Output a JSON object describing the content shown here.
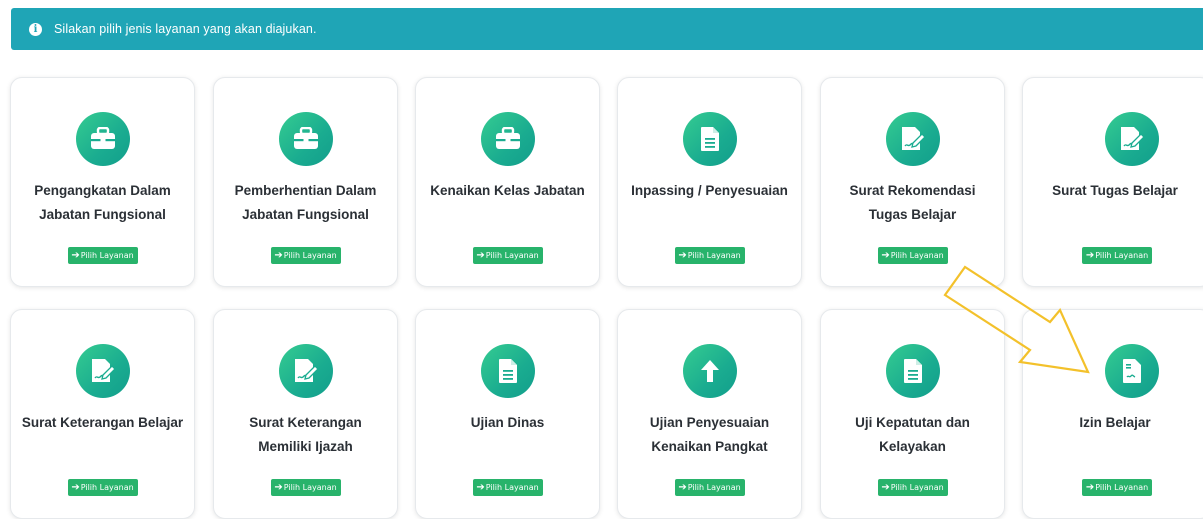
{
  "alert": {
    "icon": "info-icon",
    "text": "Silakan pilih jenis layanan yang akan diajukan."
  },
  "button_label": "Pilih Layanan",
  "services": [
    {
      "title": "Pengangkatan Dalam Jabatan Fungsional",
      "icon": "briefcase-icon"
    },
    {
      "title": "Pemberhentian Dalam Jabatan Fungsional",
      "icon": "briefcase-icon"
    },
    {
      "title": "Kenaikan Kelas Jabatan",
      "icon": "briefcase-icon"
    },
    {
      "title": "Inpassing / Penyesuaian",
      "icon": "document-icon"
    },
    {
      "title": "Surat Rekomendasi Tugas Belajar",
      "icon": "signature-icon"
    },
    {
      "title": "Surat Tugas Belajar",
      "icon": "signature-icon"
    },
    {
      "title": "Surat Keterangan Belajar",
      "icon": "signature-icon"
    },
    {
      "title": "Surat Keterangan Memiliki Ijazah",
      "icon": "signature-icon"
    },
    {
      "title": "Ujian Dinas",
      "icon": "document-icon"
    },
    {
      "title": "Ujian Penyesuaian Kenaikan Pangkat",
      "icon": "arrow-up-icon"
    },
    {
      "title": "Uji Kepatutan dan Kelayakan",
      "icon": "document-icon"
    },
    {
      "title": "Izin Belajar",
      "icon": "contract-icon"
    }
  ],
  "colors": {
    "alert_bg": "#1fa5b6",
    "icon_circle": "#1aac90",
    "button": "#28b36b",
    "annotation_arrow": "#f3c12b"
  }
}
